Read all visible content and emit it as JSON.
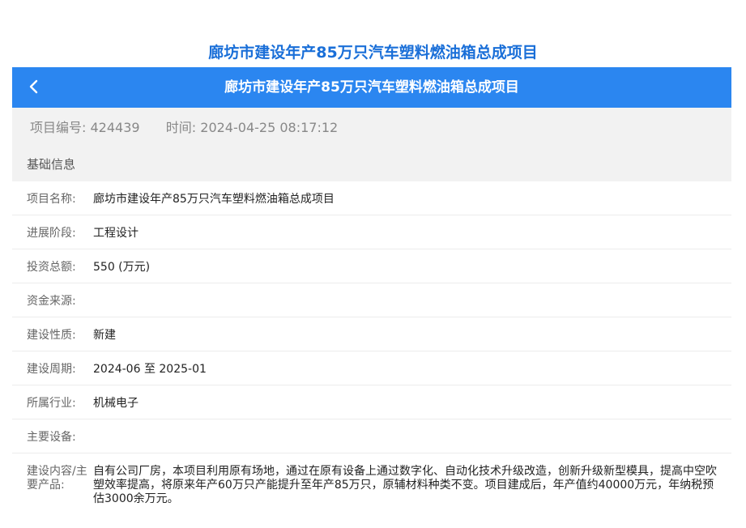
{
  "page_heading": "廊坊市建设年产85万只汽车塑料燃油箱总成项目",
  "navbar": {
    "back_icon": "chevron-left-icon",
    "title": "廊坊市建设年产85万只汽车塑料燃油箱总成项目"
  },
  "meta": {
    "id_label": "项目编号:",
    "id_value": "424439",
    "time_label": "时间:",
    "time_value": "2024-04-25 08:17:12"
  },
  "section_title": "基础信息",
  "fields": [
    {
      "label": "项目名称:",
      "value": "廊坊市建设年产85万只汽车塑料燃油箱总成项目"
    },
    {
      "label": "进展阶段:",
      "value": "工程设计"
    },
    {
      "label": "投资总额:",
      "value": "550 (万元)"
    },
    {
      "label": "资金来源:",
      "value": ""
    },
    {
      "label": "建设性质:",
      "value": "新建"
    },
    {
      "label": "建设周期:",
      "value": "2024-06 至 2025-01"
    },
    {
      "label": "所属行业:",
      "value": "机械电子"
    },
    {
      "label": "主要设备:",
      "value": ""
    },
    {
      "label": "建设内容/主要产品:",
      "value": "自有公司厂房，本项目利用原有场地，通过在原有设备上通过数字化、自动化技术升级改造，创新升级新型模具，提高中空吹塑效率提高，将原来年产60万只产能提升至年产85万只，原辅材料种类不变。项目建成后，年产值约40000万元，年纳税预估3000余万元。"
    }
  ],
  "colors": {
    "accent": "#2b86f0",
    "heading": "#1a6fd8"
  }
}
